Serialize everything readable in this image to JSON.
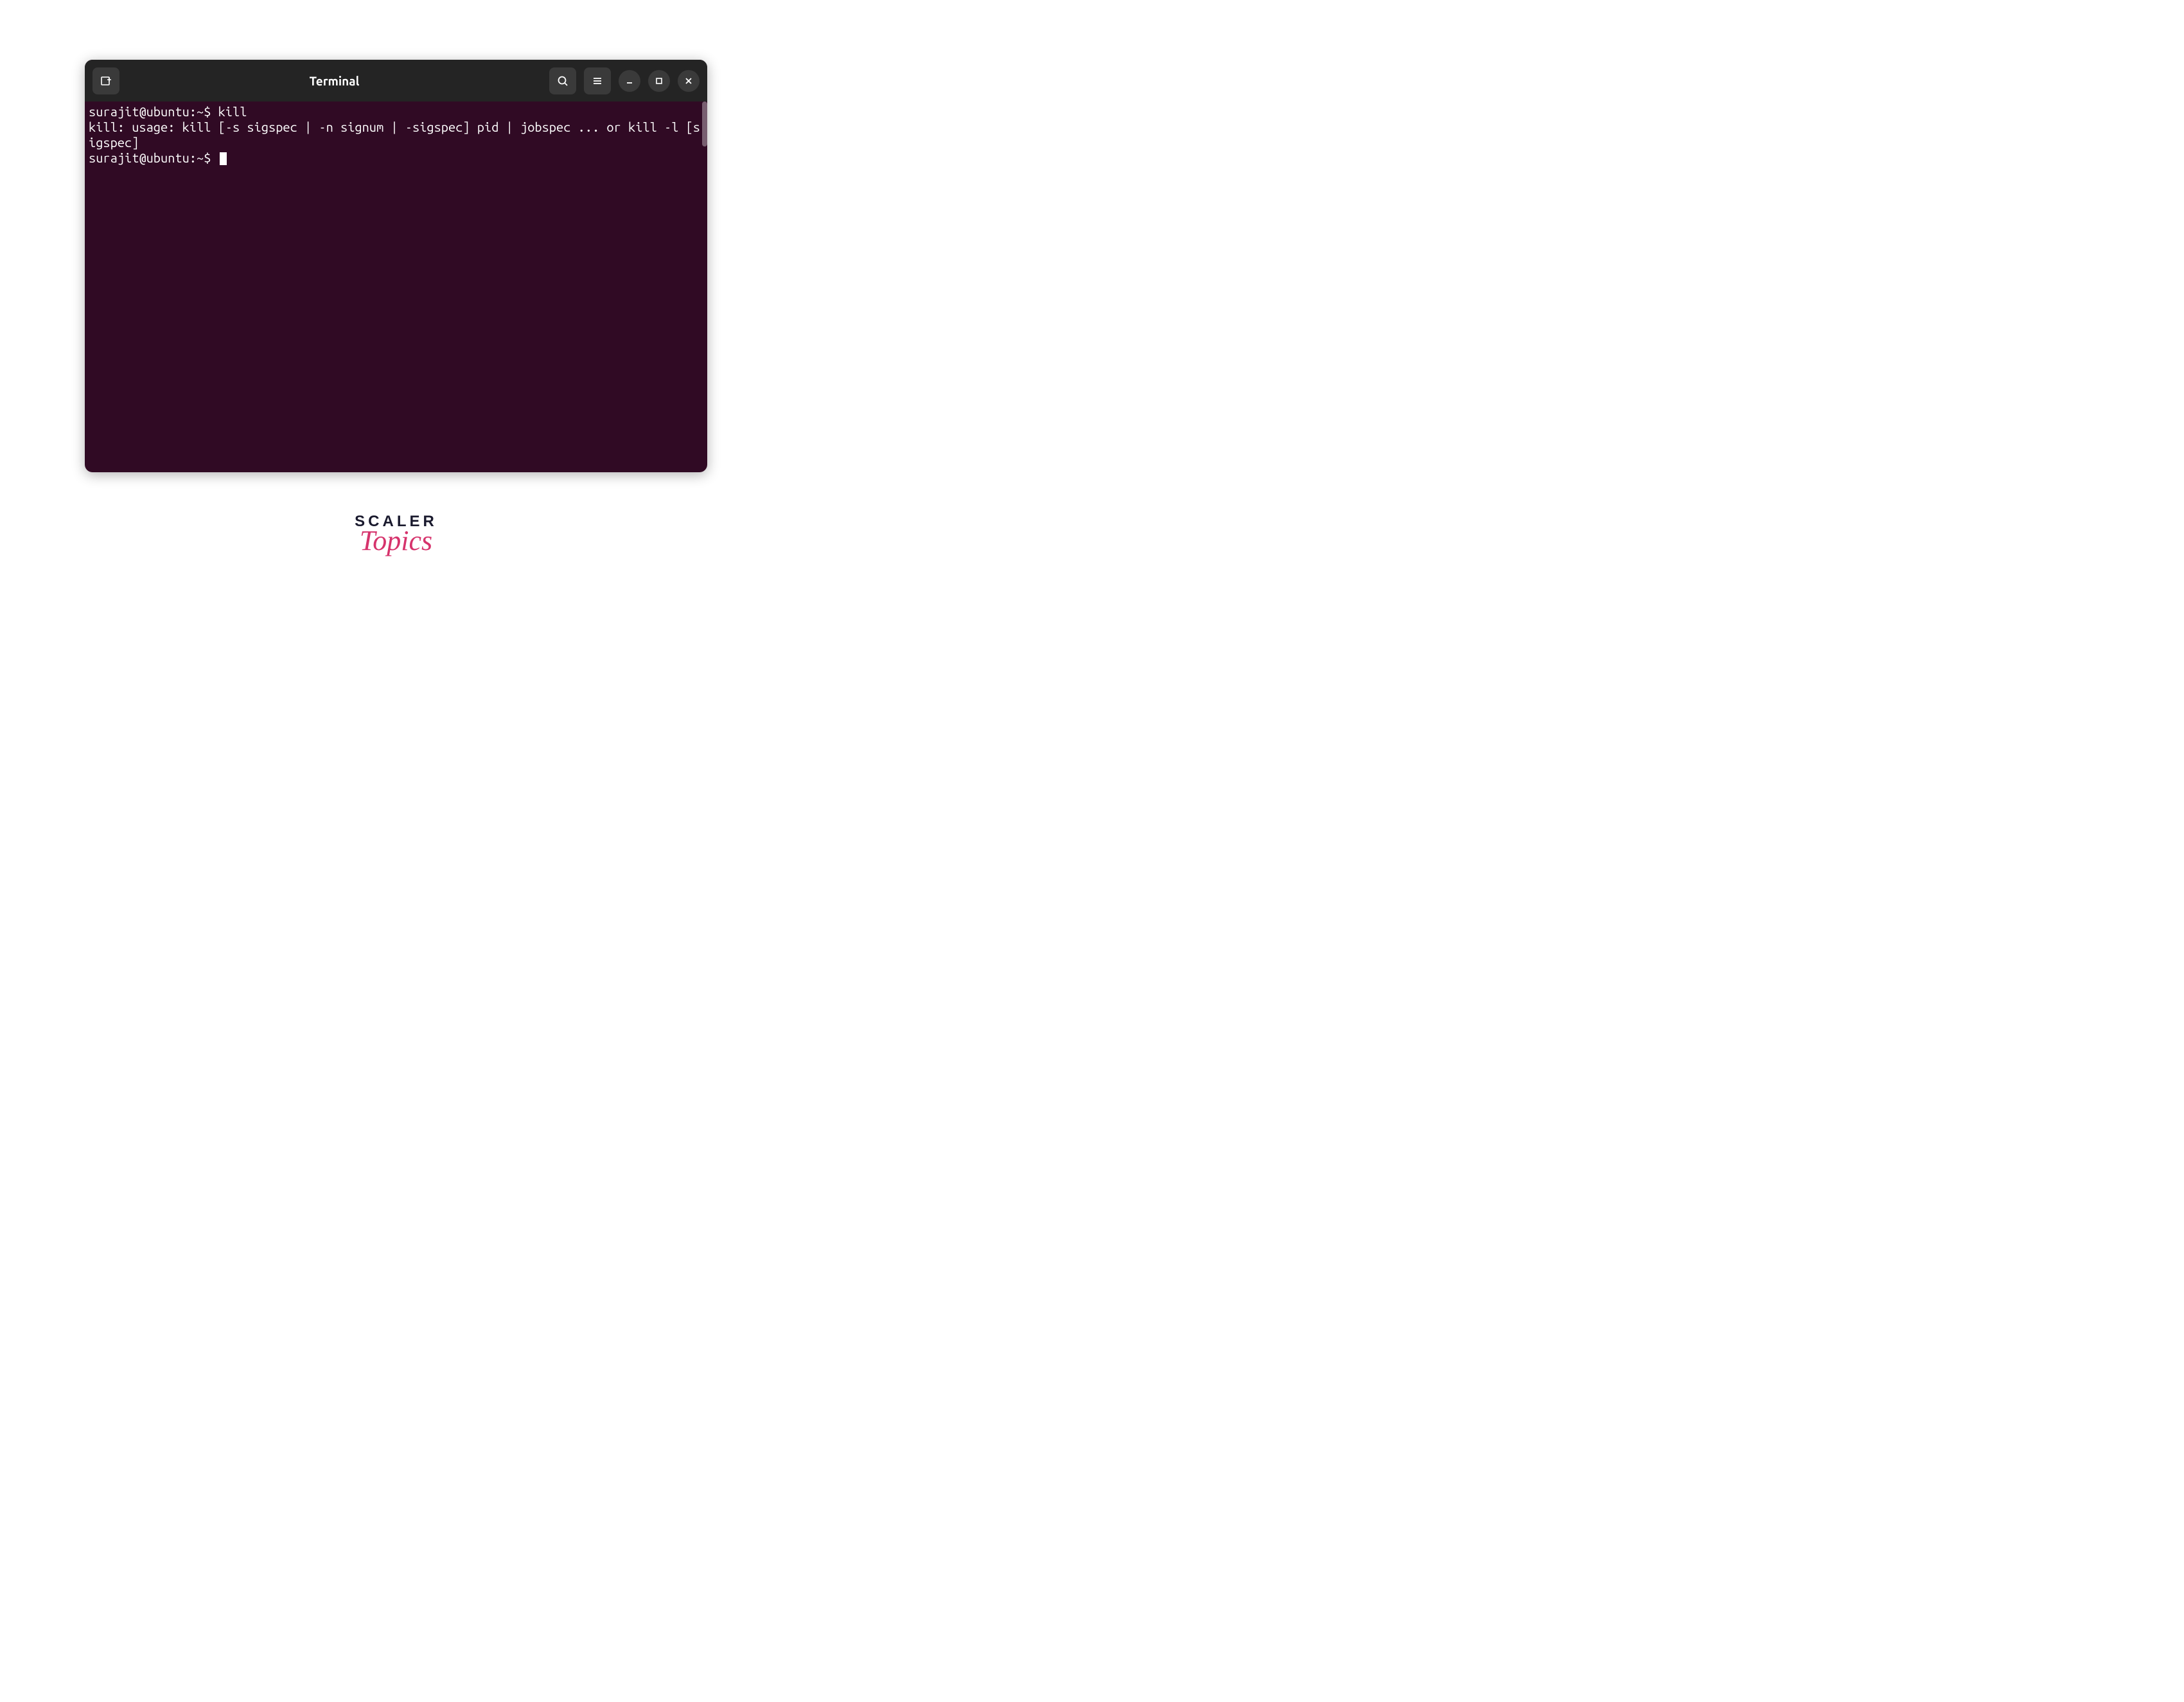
{
  "window": {
    "title": "Terminal"
  },
  "titlebar": {
    "new_tab_icon": "new-tab",
    "search_icon": "search",
    "menu_icon": "hamburger-menu",
    "minimize_icon": "minimize",
    "maximize_icon": "maximize",
    "close_icon": "close"
  },
  "terminal": {
    "lines": [
      {
        "prompt": "surajit@ubuntu:~$ ",
        "cmd": "kill"
      },
      {
        "text": "kill: usage: kill [-s sigspec | -n signum | -sigspec] pid | jobspec ... or kill -l [sigspec]"
      },
      {
        "prompt": "surajit@ubuntu:~$ ",
        "cmd": "",
        "cursor": true
      }
    ]
  },
  "branding": {
    "scaler": "SCALER",
    "topics": "Topics"
  }
}
